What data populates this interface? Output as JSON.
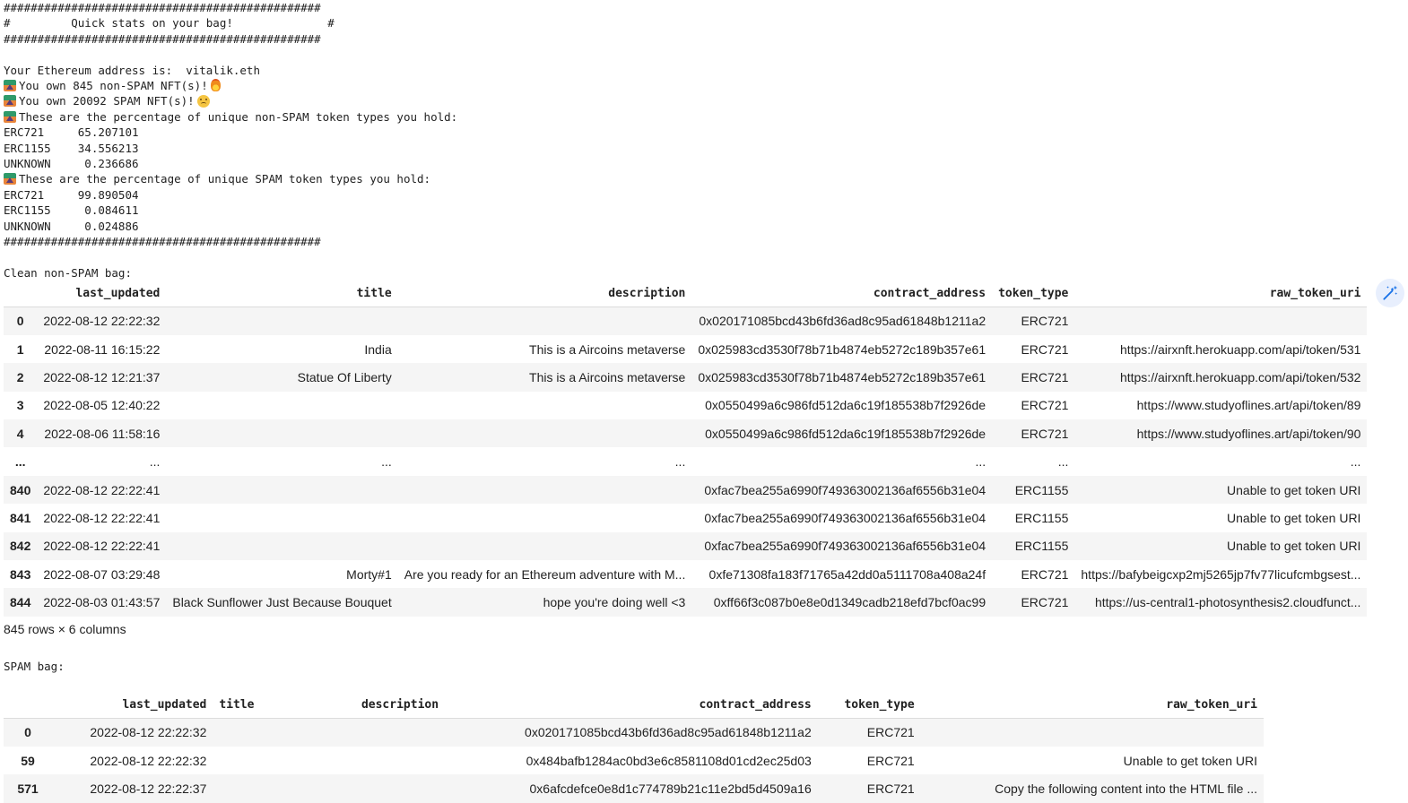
{
  "stats": {
    "hash_line": "###############################################",
    "header_line": "#         Quick stats on your bag!              #",
    "blank": "",
    "address_line": "Your Ethereum address is:  vitalik.eth",
    "non_spam_count_line": "You own 845 non-SPAM NFT(s)!",
    "spam_count_line": "You own 20092 SPAM NFT(s)!",
    "non_spam_pct_header": "These are the percentage of unique non-SPAM token types you hold:",
    "non_spam_pct": [
      "ERC721     65.207101",
      "ERC1155    34.556213",
      "UNKNOWN     0.236686"
    ],
    "spam_pct_header": "These are the percentage of unique SPAM token types you hold:",
    "spam_pct": [
      "ERC721     99.890504",
      "ERC1155     0.084611",
      "UNKNOWN     0.024886"
    ]
  },
  "clean_label": "Clean non-SPAM bag:",
  "clean_table": {
    "columns": [
      "",
      "last_updated",
      "title",
      "description",
      "contract_address",
      "token_type",
      "raw_token_uri"
    ],
    "rows": [
      [
        "0",
        "2022-08-12 22:22:32",
        "",
        "",
        "0x020171085bcd43b6fd36ad8c95ad61848b1211a2",
        "ERC721",
        ""
      ],
      [
        "1",
        "2022-08-11 16:15:22",
        "India",
        "This is a Aircoins metaverse",
        "0x025983cd3530f78b71b4874eb5272c189b357e61",
        "ERC721",
        "https://airxnft.herokuapp.com/api/token/531"
      ],
      [
        "2",
        "2022-08-12 12:21:37",
        "Statue Of Liberty",
        "This is a Aircoins metaverse",
        "0x025983cd3530f78b71b4874eb5272c189b357e61",
        "ERC721",
        "https://airxnft.herokuapp.com/api/token/532"
      ],
      [
        "3",
        "2022-08-05 12:40:22",
        "",
        "",
        "0x0550499a6c986fd512da6c19f185538b7f2926de",
        "ERC721",
        "https://www.studyoflines.art/api/token/89"
      ],
      [
        "4",
        "2022-08-06 11:58:16",
        "",
        "",
        "0x0550499a6c986fd512da6c19f185538b7f2926de",
        "ERC721",
        "https://www.studyoflines.art/api/token/90"
      ],
      [
        "...",
        "...",
        "...",
        "...",
        "...",
        "...",
        "..."
      ],
      [
        "840",
        "2022-08-12 22:22:41",
        "",
        "",
        "0xfac7bea255a6990f749363002136af6556b31e04",
        "ERC1155",
        "Unable to get token URI"
      ],
      [
        "841",
        "2022-08-12 22:22:41",
        "",
        "",
        "0xfac7bea255a6990f749363002136af6556b31e04",
        "ERC1155",
        "Unable to get token URI"
      ],
      [
        "842",
        "2022-08-12 22:22:41",
        "",
        "",
        "0xfac7bea255a6990f749363002136af6556b31e04",
        "ERC1155",
        "Unable to get token URI"
      ],
      [
        "843",
        "2022-08-07 03:29:48",
        "Morty#1",
        "Are you ready for an Ethereum adventure with M...",
        "0xfe71308fa183f71765a42dd0a5111708a408a24f",
        "ERC721",
        "https://bafybeigcxp2mj5265jp7fv77licufcmbgsest..."
      ],
      [
        "844",
        "2022-08-03 01:43:57",
        "Black Sunflower Just Because Bouquet",
        "hope you're doing well <3",
        "0xff66f3c087b0e8e0d1349cadb218efd7bcf0ac99",
        "ERC721",
        "https://us-central1-photosynthesis2.cloudfunct..."
      ]
    ],
    "shape": "845 rows × 6 columns"
  },
  "spam_label": "SPAM bag:",
  "spam_table": {
    "columns": [
      "",
      "last_updated",
      "title",
      "description",
      "contract_address",
      "token_type",
      "raw_token_uri"
    ],
    "rows": [
      [
        "0",
        "2022-08-12 22:22:32",
        "",
        "",
        "0x020171085bcd43b6fd36ad8c95ad61848b1211a2",
        "ERC721",
        ""
      ],
      [
        "59",
        "2022-08-12 22:22:32",
        "",
        "",
        "0x484bafb1284ac0bd3e6c8581108d01cd2ec25d03",
        "ERC721",
        "Unable to get token URI"
      ],
      [
        "571",
        "2022-08-12 22:22:37",
        "",
        "",
        "0x6afcdefce0e8d1c774789b21c11e2bd5d4509a16",
        "ERC721",
        "Copy the following content into the HTML file ..."
      ]
    ]
  },
  "icons": {
    "emoji_sunrise": "sunrise-over-mountains-icon",
    "emoji_fire": "fire-icon",
    "emoji_sad": "sad-face-icon",
    "magic_button": "magic-wand-sparkle-icon"
  },
  "colors": {
    "accent": "#1a73e8",
    "row_stripe": "#f5f5f5"
  }
}
